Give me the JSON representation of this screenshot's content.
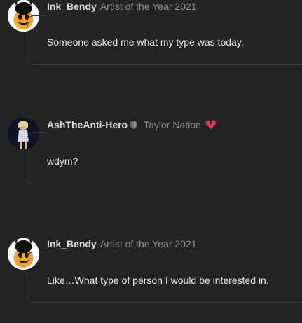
{
  "posts": [
    {
      "username": "Ink_Bendy",
      "user_title": "Artist of the Year 2021",
      "avatar_icon": "bendy-avatar-icon",
      "message": "Someone asked me what my type was today."
    },
    {
      "username": "AshTheAnti-Hero",
      "user_title": "Taylor Nation",
      "avatar_icon": "performer-avatar-icon",
      "badge_icon": "shield-icon",
      "extra_icon": "broken-heart-icon",
      "message": "wdym?"
    },
    {
      "username": "Ink_Bendy",
      "user_title": "Artist of the Year 2021",
      "avatar_icon": "bendy-avatar-icon",
      "message": "Like…What type of person I would be interested in."
    }
  ],
  "colors": {
    "background": "#242424",
    "username": "#d8d8d8",
    "user_title": "#8e8e8e",
    "message": "#e8e8e8",
    "border": "#3a3a3a",
    "heart": "#e23b4f"
  }
}
